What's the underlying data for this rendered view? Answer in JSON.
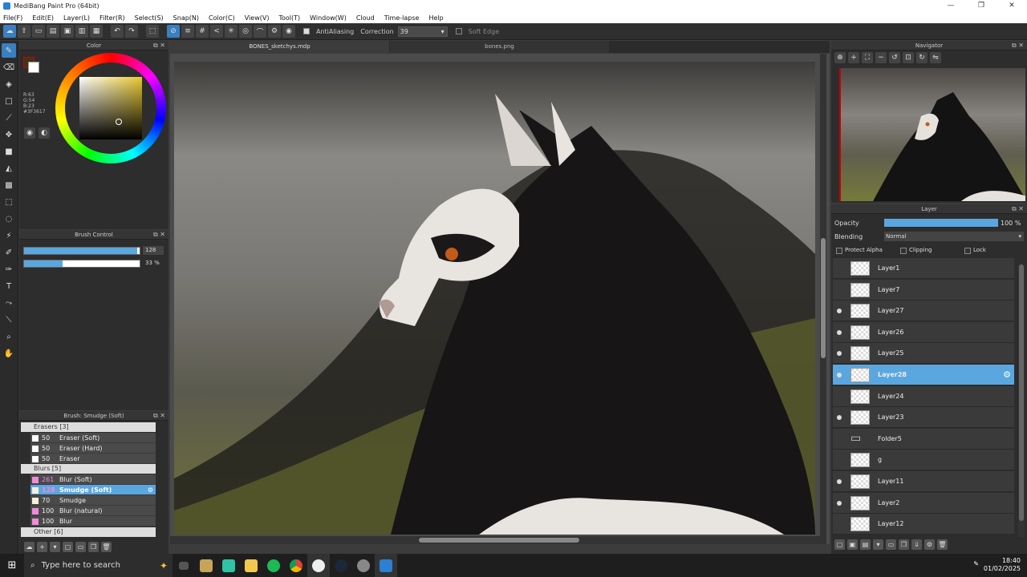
{
  "window": {
    "title": "MediBang Paint Pro (64bit)",
    "controls": [
      "—",
      "❐",
      "✕"
    ]
  },
  "menu": [
    "File(F)",
    "Edit(E)",
    "Layer(L)",
    "Filter(R)",
    "Select(S)",
    "Snap(N)",
    "Color(C)",
    "View(V)",
    "Tool(T)",
    "Window(W)",
    "Cloud",
    "Time-lapse",
    "Help"
  ],
  "toolbar": {
    "antialiasing_label": "AntiAliasing",
    "correction_label": "Correction",
    "correction_value": "39",
    "soft_edge_label": "Soft Edge"
  },
  "color_panel": {
    "title": "Color",
    "r": "R:63",
    "g": "G:54",
    "b": "B:23",
    "hex": "#3F3617",
    "fg": "#3f3617",
    "bg": "#ffffff"
  },
  "brush_control": {
    "title": "Brush Control",
    "size_value": "128",
    "opacity_value": "33 %",
    "size_fraction": 0.98,
    "opacity_fraction": 0.33
  },
  "brush_panel": {
    "title": "Brush: Smudge (Soft)",
    "groups": [
      {
        "label": "Erasers [3]"
      },
      {
        "label": "Blurs [5]"
      },
      {
        "label": "Other [6]"
      }
    ],
    "items": [
      {
        "size": "50",
        "label": "Eraser (Soft)",
        "color": "#ffffff"
      },
      {
        "size": "50",
        "label": "Eraser (Hard)",
        "color": "#ffffff"
      },
      {
        "size": "50",
        "label": "Eraser",
        "color": "#ffffff"
      },
      {
        "size": "261",
        "label": "Blur (Soft)",
        "color": "#f08bd8"
      },
      {
        "size": "128",
        "label": "Smudge (Soft)",
        "color": "#f7f0d8"
      },
      {
        "size": "70",
        "label": "Smudge",
        "color": "#f7f0d8"
      },
      {
        "size": "100",
        "label": "Blur (natural)",
        "color": "#f08bd8"
      },
      {
        "size": "100",
        "label": "Blur",
        "color": "#f08bd8"
      }
    ]
  },
  "tabs": [
    {
      "label": "BONES_sketchys.mdp"
    },
    {
      "label": "bones.png"
    }
  ],
  "navigator": {
    "title": "Navigator"
  },
  "layer_panel": {
    "title": "Layer",
    "opacity_label": "Opacity",
    "opacity_value": "100 %",
    "opacity_fraction": 1.0,
    "blending_label": "Blending",
    "blending_value": "Normal",
    "protect_alpha": "Protect Alpha",
    "clipping": "Clipping",
    "lock": "Lock",
    "layers": [
      {
        "name": "Layer1",
        "visible": false
      },
      {
        "name": "Layer7",
        "visible": false
      },
      {
        "name": "Layer27",
        "visible": true
      },
      {
        "name": "Layer26",
        "visible": true
      },
      {
        "name": "Layer25",
        "visible": true
      },
      {
        "name": "Layer28",
        "visible": true,
        "selected": true
      },
      {
        "name": "Layer24",
        "visible": false
      },
      {
        "name": "Layer23",
        "visible": true
      },
      {
        "name": "Folder5",
        "visible": false,
        "folder": true
      },
      {
        "name": "g",
        "visible": false
      },
      {
        "name": "Layer11",
        "visible": true
      },
      {
        "name": "Layer2",
        "visible": true
      },
      {
        "name": "Layer12",
        "visible": false
      }
    ]
  },
  "taskbar": {
    "search_placeholder": "Type here to search",
    "time": "18:40",
    "date": "01/02/2025"
  }
}
